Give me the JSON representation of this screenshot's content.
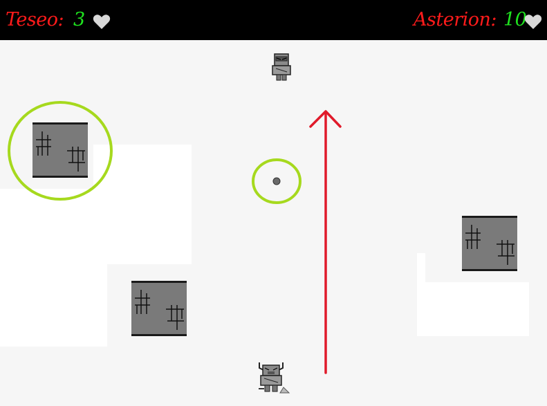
{
  "hud": {
    "player1": {
      "name": "Teseo:",
      "lives": "3",
      "icon": "heart-icon"
    },
    "player2": {
      "name": "Asterion:",
      "lives": "10",
      "icon": "heart-icon"
    }
  },
  "colors": {
    "name": "#ff1b1b",
    "lives": "#1fe41f",
    "hud_background": "#000000",
    "field": "#f6f6f6",
    "highlight_ring": "#a6d91e",
    "arrow": "#e01a2a",
    "wall": "#7a7a7a"
  },
  "sprites": {
    "enemy": "robot-enemy-icon",
    "player": "horned-minotaur-icon",
    "projectile": "ball-icon"
  }
}
